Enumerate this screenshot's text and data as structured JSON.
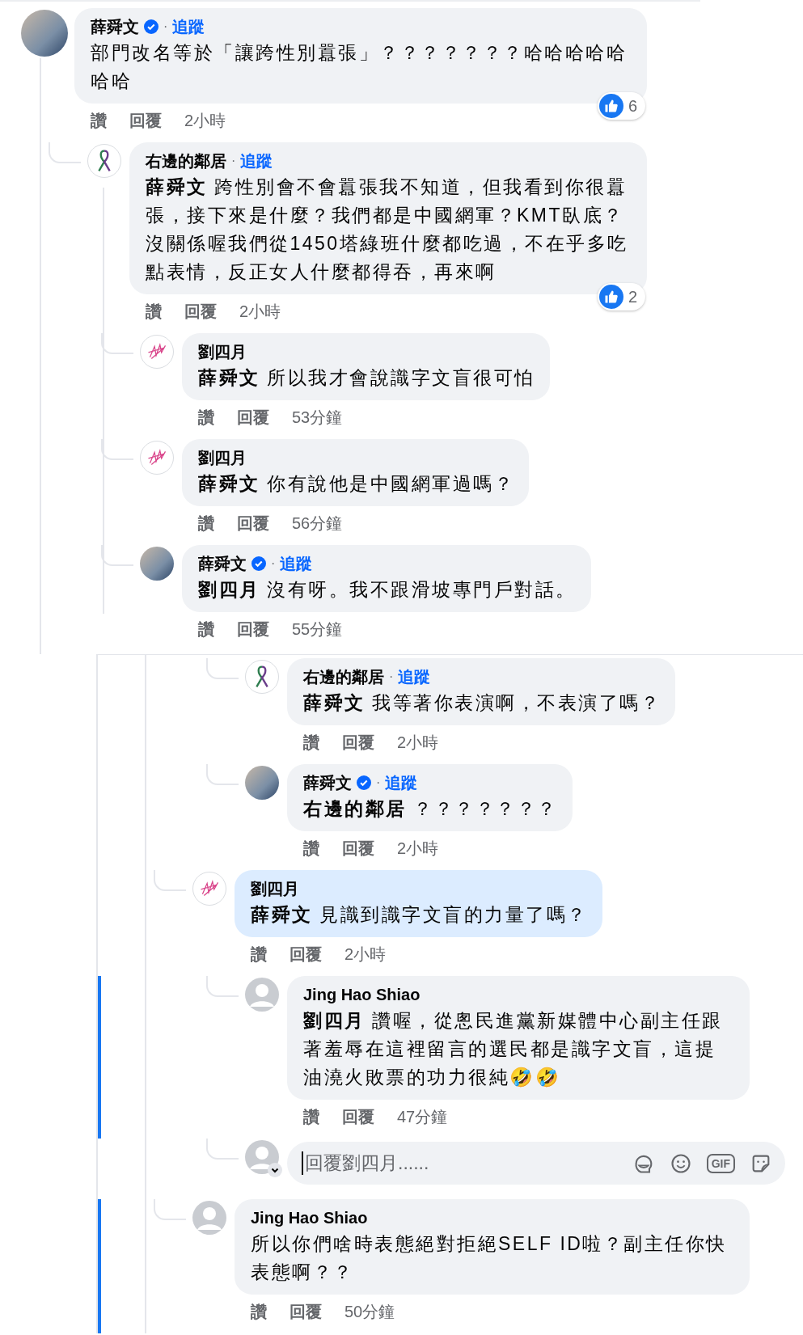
{
  "top_thread": {
    "comments": [
      {
        "author": "薛舜文",
        "kind": "photo",
        "verified": true,
        "separator": "·",
        "follow": "追蹤",
        "text": "部門改名等於「讓跨性別囂張」？？？？？？？哈哈哈哈哈哈哈",
        "like_label": "讚",
        "reply_label": "回覆",
        "time": "2小時",
        "reactions": {
          "count": "6"
        },
        "highlighted": false,
        "children": [
          {
            "author": "右邊的鄰居",
            "kind": "ribbon",
            "verified": false,
            "separator": "·",
            "follow": "追蹤",
            "mention": "薛舜文",
            "text": "跨性別會不會囂張我不知道，但我看到你很囂張，接下來是什麼？我們都是中國網軍？KMT臥底？沒關係喔我們從1450塔綠班什麼都吃過，不在乎多吃點表情，反正女人什麼都得吞，再來啊",
            "like_label": "讚",
            "reply_label": "回覆",
            "time": "2小時",
            "reactions": {
              "count": "2"
            },
            "highlighted": false,
            "children": [
              {
                "author": "劉四月",
                "kind": "scribble",
                "verified": false,
                "mention": "薛舜文",
                "text": "所以我才會說識字文盲很可怕",
                "like_label": "讚",
                "reply_label": "回覆",
                "time": "53分鐘",
                "highlighted": false
              },
              {
                "author": "劉四月",
                "kind": "scribble",
                "verified": false,
                "mention": "薛舜文",
                "text": "你有說他是中國網軍過嗎？",
                "like_label": "讚",
                "reply_label": "回覆",
                "time": "56分鐘",
                "highlighted": false
              },
              {
                "author": "薛舜文",
                "kind": "photo",
                "verified": true,
                "separator": "·",
                "follow": "追蹤",
                "mention": "劉四月",
                "text": "沒有呀。我不跟滑坡專門戶對話。",
                "like_label": "讚",
                "reply_label": "回覆",
                "time": "55分鐘",
                "highlighted": false
              }
            ]
          }
        ]
      }
    ]
  },
  "bottom_thread": {
    "continued_replies": [
      {
        "author": "右邊的鄰居",
        "kind": "ribbon",
        "verified": false,
        "separator": "·",
        "follow": "追蹤",
        "mention": "薛舜文",
        "text": "我等著你表演啊，不表演了嗎？",
        "like_label": "讚",
        "reply_label": "回覆",
        "time": "2小時",
        "highlighted": false,
        "marked": false
      },
      {
        "author": "薛舜文",
        "kind": "photo",
        "verified": true,
        "separator": "·",
        "follow": "追蹤",
        "mention": "右邊的鄰居",
        "text": "？？？？？？？",
        "like_label": "讚",
        "reply_label": "回覆",
        "time": "2小時",
        "highlighted": false,
        "marked": false
      }
    ],
    "comments": [
      {
        "author": "劉四月",
        "kind": "scribble",
        "verified": false,
        "mention": "薛舜文",
        "text": "見識到識字文盲的力量了嗎？",
        "like_label": "讚",
        "reply_label": "回覆",
        "time": "2小時",
        "highlighted": true,
        "marked": false,
        "children": [
          {
            "author": "Jing Hao Shiao",
            "kind": "silhouette",
            "verified": false,
            "mention": "劉四月",
            "text": "讚喔，從悤民進黨新媒體中心副主任跟著羞辱在這裡留言的選民都是識字文盲，這提油澆火敗票的功力很純🤣🤣",
            "like_label": "讚",
            "reply_label": "回覆",
            "time": "47分鐘",
            "highlighted": false,
            "marked": true
          }
        ],
        "reply_box": {
          "placeholder": "回覆劉四月......",
          "gif_label": "GIF"
        }
      },
      {
        "author": "Jing Hao Shiao",
        "kind": "silhouette",
        "verified": false,
        "text": "所以你們啥時表態絕對拒絕SELF ID啦？副主任你快表態啊？？",
        "like_label": "讚",
        "reply_label": "回覆",
        "time": "50分鐘",
        "highlighted": false,
        "marked": true
      }
    ]
  }
}
